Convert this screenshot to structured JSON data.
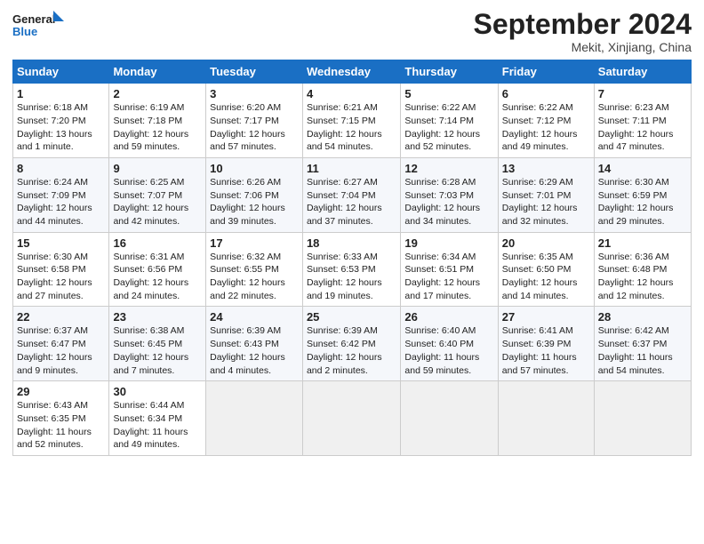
{
  "header": {
    "logo_line1": "General",
    "logo_line2": "Blue",
    "month": "September 2024",
    "location": "Mekit, Xinjiang, China"
  },
  "weekdays": [
    "Sunday",
    "Monday",
    "Tuesday",
    "Wednesday",
    "Thursday",
    "Friday",
    "Saturday"
  ],
  "weeks": [
    [
      {
        "day": 1,
        "detail": "Sunrise: 6:18 AM\nSunset: 7:20 PM\nDaylight: 13 hours\nand 1 minute."
      },
      {
        "day": 2,
        "detail": "Sunrise: 6:19 AM\nSunset: 7:18 PM\nDaylight: 12 hours\nand 59 minutes."
      },
      {
        "day": 3,
        "detail": "Sunrise: 6:20 AM\nSunset: 7:17 PM\nDaylight: 12 hours\nand 57 minutes."
      },
      {
        "day": 4,
        "detail": "Sunrise: 6:21 AM\nSunset: 7:15 PM\nDaylight: 12 hours\nand 54 minutes."
      },
      {
        "day": 5,
        "detail": "Sunrise: 6:22 AM\nSunset: 7:14 PM\nDaylight: 12 hours\nand 52 minutes."
      },
      {
        "day": 6,
        "detail": "Sunrise: 6:22 AM\nSunset: 7:12 PM\nDaylight: 12 hours\nand 49 minutes."
      },
      {
        "day": 7,
        "detail": "Sunrise: 6:23 AM\nSunset: 7:11 PM\nDaylight: 12 hours\nand 47 minutes."
      }
    ],
    [
      {
        "day": 8,
        "detail": "Sunrise: 6:24 AM\nSunset: 7:09 PM\nDaylight: 12 hours\nand 44 minutes."
      },
      {
        "day": 9,
        "detail": "Sunrise: 6:25 AM\nSunset: 7:07 PM\nDaylight: 12 hours\nand 42 minutes."
      },
      {
        "day": 10,
        "detail": "Sunrise: 6:26 AM\nSunset: 7:06 PM\nDaylight: 12 hours\nand 39 minutes."
      },
      {
        "day": 11,
        "detail": "Sunrise: 6:27 AM\nSunset: 7:04 PM\nDaylight: 12 hours\nand 37 minutes."
      },
      {
        "day": 12,
        "detail": "Sunrise: 6:28 AM\nSunset: 7:03 PM\nDaylight: 12 hours\nand 34 minutes."
      },
      {
        "day": 13,
        "detail": "Sunrise: 6:29 AM\nSunset: 7:01 PM\nDaylight: 12 hours\nand 32 minutes."
      },
      {
        "day": 14,
        "detail": "Sunrise: 6:30 AM\nSunset: 6:59 PM\nDaylight: 12 hours\nand 29 minutes."
      }
    ],
    [
      {
        "day": 15,
        "detail": "Sunrise: 6:30 AM\nSunset: 6:58 PM\nDaylight: 12 hours\nand 27 minutes."
      },
      {
        "day": 16,
        "detail": "Sunrise: 6:31 AM\nSunset: 6:56 PM\nDaylight: 12 hours\nand 24 minutes."
      },
      {
        "day": 17,
        "detail": "Sunrise: 6:32 AM\nSunset: 6:55 PM\nDaylight: 12 hours\nand 22 minutes."
      },
      {
        "day": 18,
        "detail": "Sunrise: 6:33 AM\nSunset: 6:53 PM\nDaylight: 12 hours\nand 19 minutes."
      },
      {
        "day": 19,
        "detail": "Sunrise: 6:34 AM\nSunset: 6:51 PM\nDaylight: 12 hours\nand 17 minutes."
      },
      {
        "day": 20,
        "detail": "Sunrise: 6:35 AM\nSunset: 6:50 PM\nDaylight: 12 hours\nand 14 minutes."
      },
      {
        "day": 21,
        "detail": "Sunrise: 6:36 AM\nSunset: 6:48 PM\nDaylight: 12 hours\nand 12 minutes."
      }
    ],
    [
      {
        "day": 22,
        "detail": "Sunrise: 6:37 AM\nSunset: 6:47 PM\nDaylight: 12 hours\nand 9 minutes."
      },
      {
        "day": 23,
        "detail": "Sunrise: 6:38 AM\nSunset: 6:45 PM\nDaylight: 12 hours\nand 7 minutes."
      },
      {
        "day": 24,
        "detail": "Sunrise: 6:39 AM\nSunset: 6:43 PM\nDaylight: 12 hours\nand 4 minutes."
      },
      {
        "day": 25,
        "detail": "Sunrise: 6:39 AM\nSunset: 6:42 PM\nDaylight: 12 hours\nand 2 minutes."
      },
      {
        "day": 26,
        "detail": "Sunrise: 6:40 AM\nSunset: 6:40 PM\nDaylight: 11 hours\nand 59 minutes."
      },
      {
        "day": 27,
        "detail": "Sunrise: 6:41 AM\nSunset: 6:39 PM\nDaylight: 11 hours\nand 57 minutes."
      },
      {
        "day": 28,
        "detail": "Sunrise: 6:42 AM\nSunset: 6:37 PM\nDaylight: 11 hours\nand 54 minutes."
      }
    ],
    [
      {
        "day": 29,
        "detail": "Sunrise: 6:43 AM\nSunset: 6:35 PM\nDaylight: 11 hours\nand 52 minutes."
      },
      {
        "day": 30,
        "detail": "Sunrise: 6:44 AM\nSunset: 6:34 PM\nDaylight: 11 hours\nand 49 minutes."
      },
      null,
      null,
      null,
      null,
      null
    ]
  ]
}
